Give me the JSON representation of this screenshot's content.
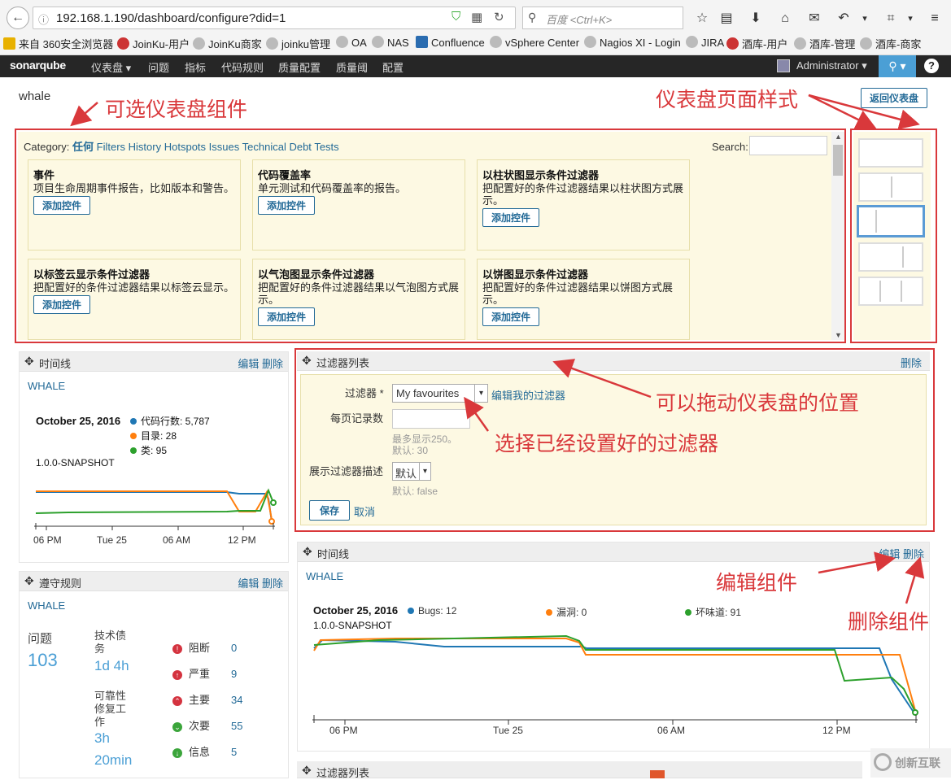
{
  "browser": {
    "url": "192.168.1.190/dashboard/configure?did=1",
    "search_placeholder": "百度 <Ctrl+K>"
  },
  "bookmarks": [
    "来自 360安全浏览器",
    "JoinKu-用户",
    "JoinKu商家",
    "joinku管理",
    "OA",
    "NAS",
    "Confluence",
    "vSphere Center",
    "Nagios XI - Login",
    "JIRA",
    "酒库-用户",
    "酒库-管理",
    "酒库-商家"
  ],
  "nav": {
    "logo": "sonarqube",
    "items": [
      "仪表盘 ▾",
      "问题",
      "指标",
      "代码规则",
      "质量配置",
      "质量阈",
      "配置"
    ],
    "user": "Administrator ▾"
  },
  "page": {
    "title": "whale",
    "back_button": "返回仪表盘"
  },
  "catalog": {
    "category_label": "Category:",
    "categories": [
      "任何",
      "Filters",
      "History",
      "Hotspots",
      "Issues",
      "Technical Debt",
      "Tests"
    ],
    "search_label": "Search:",
    "add_button": "添加控件",
    "widgets": [
      {
        "title": "事件",
        "desc": "项目生命周期事件报告，比如版本和警告。"
      },
      {
        "title": "代码覆盖率",
        "desc": "单元测试和代码覆盖率的报告。"
      },
      {
        "title": "以柱状图显示条件过滤器",
        "desc": "把配置好的条件过滤器结果以柱状图方式展示。"
      },
      {
        "title": "以标签云显示条件过滤器",
        "desc": "把配置好的条件过滤器结果以标签云显示。"
      },
      {
        "title": "以气泡图显示条件过滤器",
        "desc": "把配置好的条件过滤器结果以气泡图方式展示。"
      },
      {
        "title": "以饼图显示条件过滤器",
        "desc": "把配置好的条件过滤器结果以饼图方式展示。"
      }
    ]
  },
  "timeline1": {
    "header": "时间线",
    "edit": "编辑",
    "delete": "删除",
    "project": "WHALE",
    "date": "October 25, 2016",
    "version": "1.0.0-SNAPSHOT",
    "legend": [
      {
        "label": "代码行数: 5,787",
        "color": "#1f77b4"
      },
      {
        "label": "目录: 28",
        "color": "#ff7f0e"
      },
      {
        "label": "类: 95",
        "color": "#2ca02c"
      }
    ],
    "x_ticks": [
      "06 PM",
      "Tue 25",
      "06 AM",
      "12 PM"
    ]
  },
  "rules": {
    "header": "遵守规则",
    "edit": "编辑",
    "delete": "删除",
    "project": "WHALE",
    "issues_label": "问题",
    "issues_value": "103",
    "debt_label": "技术债务",
    "debt_value": "1d 4h",
    "rel_label": "可靠性修复工作",
    "rel_value1": "3h",
    "rel_value2": "20min",
    "severities": [
      {
        "label": "阻断",
        "count": "0",
        "color": "#d4333f",
        "glyph": "!"
      },
      {
        "label": "严重",
        "count": "9",
        "color": "#d4333f",
        "glyph": "↑"
      },
      {
        "label": "主要",
        "count": "34",
        "color": "#d4333f",
        "glyph": "⌃"
      },
      {
        "label": "次要",
        "count": "55",
        "color": "#3ba53b",
        "glyph": "⌄"
      },
      {
        "label": "信息",
        "count": "5",
        "color": "#3ba53b",
        "glyph": "↓"
      }
    ]
  },
  "filterlist": {
    "header": "过滤器列表",
    "delete": "删除",
    "filter_label": "过滤器 *",
    "filter_value": "My favourites",
    "edit_filters": "编辑我的过滤器",
    "per_page_label": "每页记录数",
    "per_page_hint1": "最多显示250。",
    "per_page_hint2": "默认: 30",
    "show_desc_label": "展示过滤器描述",
    "show_desc_value": "默认",
    "show_desc_hint": "默认: false",
    "save": "保存",
    "cancel": "取消"
  },
  "timeline2": {
    "header": "时间线",
    "edit": "编辑",
    "delete": "删除",
    "project": "WHALE",
    "date": "October 25, 2016",
    "version": "1.0.0-SNAPSHOT",
    "legend": [
      {
        "label": "Bugs: 12",
        "color": "#1f77b4"
      },
      {
        "label": "漏洞: 0",
        "color": "#ff7f0e"
      },
      {
        "label": "坏味道: 91",
        "color": "#2ca02c"
      }
    ],
    "x_ticks": [
      "06 PM",
      "Tue 25",
      "06 AM",
      "12 PM"
    ]
  },
  "bottom_header": "过滤器列表",
  "annotations": {
    "optional_widgets": "可选仪表盘组件",
    "page_style": "仪表盘页面样式",
    "drag": "可以拖动仪表盘的位置",
    "select_filter": "选择已经设置好的过滤器",
    "edit_widget": "编辑组件",
    "delete_widget": "删除组件"
  },
  "watermark": "创新互联"
}
